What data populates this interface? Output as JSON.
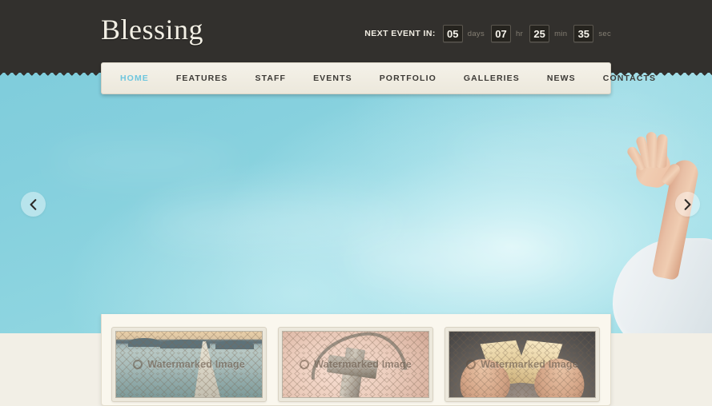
{
  "site": {
    "logo": "Blessing"
  },
  "countdown": {
    "label": "NEXT EVENT IN:",
    "days_value": "05",
    "days_unit": "days",
    "hours_value": "07",
    "hours_unit": "hr",
    "minutes_value": "25",
    "minutes_unit": "min",
    "seconds_value": "35",
    "seconds_unit": "sec"
  },
  "nav": {
    "items": [
      {
        "label": "HOME",
        "active": true
      },
      {
        "label": "FEATURES",
        "active": false
      },
      {
        "label": "STAFF",
        "active": false
      },
      {
        "label": "EVENTS",
        "active": false
      },
      {
        "label": "PORTFOLIO",
        "active": false
      },
      {
        "label": "GALLERIES",
        "active": false
      },
      {
        "label": "NEWS",
        "active": false
      },
      {
        "label": "CONTACTS",
        "active": false
      }
    ]
  },
  "slider": {
    "prev_label": "‹",
    "next_label": "›"
  },
  "thumbnails": [
    {
      "watermark": "Watermarked Image"
    },
    {
      "watermark": "Watermarked Image"
    },
    {
      "watermark": "Watermarked Image"
    }
  ],
  "colors": {
    "header_bg": "#32302d",
    "nav_bg": "#f1ede2",
    "nav_active": "#6ec6de",
    "hero_sky": "#8ed5e0",
    "panel_bg": "#faf7ee",
    "page_bg": "#f2efe6",
    "logo_text": "#f2efe4"
  }
}
